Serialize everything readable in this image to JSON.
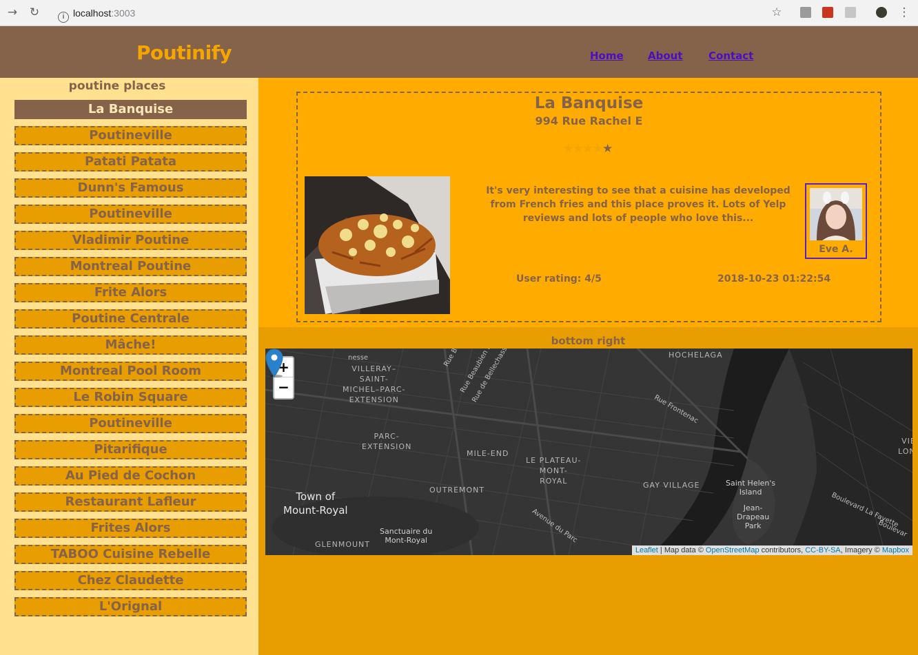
{
  "browser": {
    "url_host": "localhost",
    "url_port": ":3003"
  },
  "header": {
    "brand": "Poutinify",
    "nav": [
      {
        "label": "Home"
      },
      {
        "label": "About"
      },
      {
        "label": "Contact"
      }
    ]
  },
  "sidebar": {
    "title": "poutine places",
    "items": [
      {
        "label": "La Banquise",
        "active": true
      },
      {
        "label": "Poutineville"
      },
      {
        "label": "Patati Patata"
      },
      {
        "label": "Dunn's Famous"
      },
      {
        "label": "Poutineville"
      },
      {
        "label": "Vladimir Poutine"
      },
      {
        "label": "Montreal Poutine"
      },
      {
        "label": "Frite Alors"
      },
      {
        "label": "Poutine Centrale"
      },
      {
        "label": "Mâche!"
      },
      {
        "label": "Montreal Pool Room"
      },
      {
        "label": "Le Robin Square"
      },
      {
        "label": "Poutineville"
      },
      {
        "label": "Pitarifique"
      },
      {
        "label": "Au Pied de Cochon"
      },
      {
        "label": "Restaurant Lafleur"
      },
      {
        "label": "Frites Alors"
      },
      {
        "label": "TABOO Cuisine Rebelle"
      },
      {
        "label": "Chez Claudette"
      },
      {
        "label": "L'Orignal"
      }
    ]
  },
  "detail": {
    "name": "La Banquise",
    "address": "994 Rue Rachel E",
    "star_rating": 4,
    "star_max": 5,
    "review": "It's very interesting to see that a cuisine has developed from French fries and this place proves it. Lots of Yelp reviews and lots of people who love this...",
    "reviewer": "Eve A.",
    "user_rating": "User rating: 4/5",
    "timestamp": "2018-10-23 01:22:54"
  },
  "map_section": {
    "title": "bottom right",
    "zoom_in": "+",
    "zoom_out": "−",
    "labels": {
      "villeray": "VILLERAY–\nSAINT-\nMICHEL–PARC-\nEXTENSION",
      "parc_ext": "PARC-\nEXTENSION",
      "mile_end": "MILE-END",
      "plateau": "LE PLATEAU-\nMONT-\nROYAL",
      "outremont": "OUTREMONT",
      "town_mount_royal": "Town of\nMount-Royal",
      "sanctuaire": "Sanctuaire du\nMont-Royal",
      "glenmount": "GLENMOUNT",
      "hochelaga": "HOCHELAGA",
      "gay_village": "GAY VILLAGE",
      "saint_helen": "Saint Helen's\nIsland",
      "jean_drapeau": "Jean-\nDrapeau\nPark",
      "vieux_long": "VIEI\nLONG"
    },
    "streets": {
      "bela": "Rue Béla",
      "beaubien": "Rue Beaubien Est",
      "bellechasse": "Rue de Bellechasse",
      "frontenac": "Rue Frontenac",
      "lafayette": "Boulevard La Fayette",
      "boulevard": "Boulevar",
      "avenue_parc": "Avenue du Parc",
      "nesse": "nesse"
    },
    "attribution": {
      "leaflet": "Leaflet",
      "text1": " | Map data © ",
      "osm": "OpenStreetMap",
      "text2": " contributors, ",
      "ccbysa": "CC-BY-SA",
      "text3": ", Imagery © ",
      "mapbox": "Mapbox"
    }
  },
  "colors": {
    "header_bg": "#85634a",
    "brand": "#f5a500",
    "sidebar_bg": "#ffe18f",
    "panel_bg": "#ffab00",
    "map_section_bg": "#e89d00",
    "nav_link": "#4b0fbf",
    "marker": "#2a81cb"
  }
}
